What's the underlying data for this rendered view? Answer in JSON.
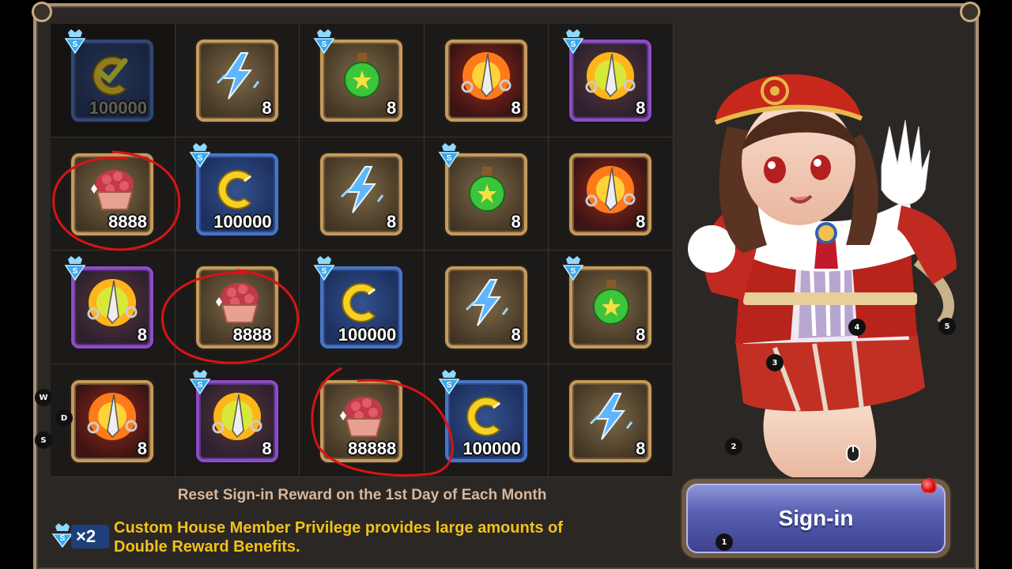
{
  "grid": {
    "cells": [
      {
        "item": "gold-coin-icon",
        "qty": "100000",
        "rarity": "blue",
        "super": true,
        "claimed": true
      },
      {
        "item": "lightning-crystal-icon",
        "qty": "8",
        "rarity": "gold",
        "super": false,
        "claimed": false
      },
      {
        "item": "green-potion-icon",
        "qty": "8",
        "rarity": "gold",
        "super": true,
        "claimed": false
      },
      {
        "item": "fire-crystal-icon",
        "qty": "8",
        "rarity": "red",
        "super": false,
        "claimed": false
      },
      {
        "item": "golden-crystal-icon",
        "qty": "8",
        "rarity": "purple",
        "super": true,
        "claimed": false
      },
      {
        "item": "cupcake-icon",
        "qty": "8888",
        "rarity": "gold",
        "super": false,
        "claimed": false
      },
      {
        "item": "gold-coin-icon",
        "qty": "100000",
        "rarity": "blue",
        "super": true,
        "claimed": false
      },
      {
        "item": "lightning-crystal-icon",
        "qty": "8",
        "rarity": "gold",
        "super": false,
        "claimed": false
      },
      {
        "item": "green-potion-icon",
        "qty": "8",
        "rarity": "gold",
        "super": true,
        "claimed": false
      },
      {
        "item": "fire-crystal-icon",
        "qty": "8",
        "rarity": "red",
        "super": false,
        "claimed": false
      },
      {
        "item": "golden-crystal-icon",
        "qty": "8",
        "rarity": "purple",
        "super": true,
        "claimed": false
      },
      {
        "item": "cupcake-icon",
        "qty": "8888",
        "rarity": "gold",
        "super": false,
        "claimed": false
      },
      {
        "item": "gold-coin-icon",
        "qty": "100000",
        "rarity": "blue",
        "super": true,
        "claimed": false
      },
      {
        "item": "lightning-crystal-icon",
        "qty": "8",
        "rarity": "gold",
        "super": false,
        "claimed": false
      },
      {
        "item": "green-potion-icon",
        "qty": "8",
        "rarity": "gold",
        "super": true,
        "claimed": false
      },
      {
        "item": "fire-crystal-icon",
        "qty": "8",
        "rarity": "red",
        "super": false,
        "claimed": false
      },
      {
        "item": "golden-crystal-icon",
        "qty": "8",
        "rarity": "purple",
        "super": true,
        "claimed": false
      },
      {
        "item": "cupcake-icon",
        "qty": "88888",
        "rarity": "gold",
        "super": false,
        "claimed": false
      },
      {
        "item": "gold-coin-icon",
        "qty": "100000",
        "rarity": "blue",
        "super": true,
        "claimed": false
      },
      {
        "item": "lightning-crystal-icon",
        "qty": "8",
        "rarity": "gold",
        "super": false,
        "claimed": false
      }
    ]
  },
  "footer": {
    "reset_text": "Reset Sign-in Reward on the 1st Day of Each Month",
    "multiplier_label": "×2",
    "privilege_line1": "Custom House Member Privilege provides large amounts of",
    "privilege_line2": "Double Reward Benefits."
  },
  "signin": {
    "label": "Sign-in"
  },
  "hints": {
    "w": "W",
    "d": "D",
    "s": "S",
    "h1": "1",
    "h2": "2",
    "h3": "3",
    "h4": "4",
    "h5": "5"
  },
  "colors": {
    "accent_gold": "#f1c21b",
    "button_blue": "#5a61b2",
    "circle_red": "#d81414"
  }
}
